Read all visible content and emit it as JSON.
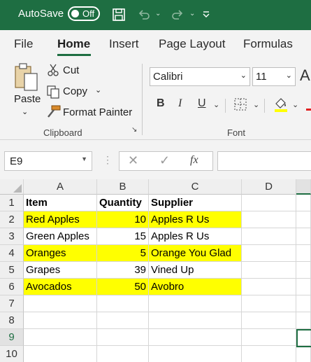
{
  "titlebar": {
    "autosave_label": "AutoSave",
    "autosave_state": "Off"
  },
  "tabs": [
    {
      "label": "File"
    },
    {
      "label": "Home"
    },
    {
      "label": "Insert"
    },
    {
      "label": "Page Layout"
    },
    {
      "label": "Formulas"
    }
  ],
  "clipboard": {
    "paste_label": "Paste",
    "cut_label": "Cut",
    "copy_label": "Copy",
    "format_painter_label": "Format Painter",
    "group_label": "Clipboard"
  },
  "font": {
    "name": "Calibri",
    "size": "11",
    "bold_label": "B",
    "italic_label": "I",
    "underline_label": "U",
    "group_label": "Font"
  },
  "formula_bar": {
    "name_box": "E9",
    "fx_label": "fx",
    "formula": ""
  },
  "grid": {
    "columns": [
      "A",
      "B",
      "C",
      "D"
    ],
    "rows": [
      {
        "num": "1",
        "a": "Item",
        "b": "Quantity",
        "c": "Supplier"
      },
      {
        "num": "2",
        "a": "Red Apples",
        "b": "10",
        "c": "Apples R Us"
      },
      {
        "num": "3",
        "a": "Green Apples",
        "b": "15",
        "c": "Apples R Us"
      },
      {
        "num": "4",
        "a": "Oranges",
        "b": "5",
        "c": "Orange You Glad"
      },
      {
        "num": "5",
        "a": "Grapes",
        "b": "39",
        "c": "Vined Up"
      },
      {
        "num": "6",
        "a": "Avocados",
        "b": "50",
        "c": "Avobro"
      },
      {
        "num": "7",
        "a": "",
        "b": "",
        "c": ""
      },
      {
        "num": "8",
        "a": "",
        "b": "",
        "c": ""
      },
      {
        "num": "9",
        "a": "",
        "b": "",
        "c": ""
      },
      {
        "num": "10",
        "a": "",
        "b": "",
        "c": ""
      }
    ],
    "selected_cell": "E9"
  },
  "colors": {
    "accent": "#1e6e42",
    "highlight": "#ffff00"
  }
}
